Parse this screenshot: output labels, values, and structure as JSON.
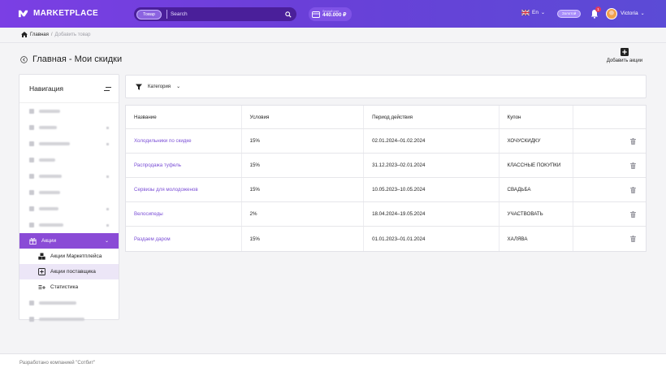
{
  "header": {
    "logo_text": "MARKETPLACE",
    "search": {
      "scope_label": "Товар",
      "placeholder": "Search"
    },
    "balance": {
      "label": "Личный счет",
      "value": "440.000 ₽"
    },
    "language": "En",
    "level_badge": "Золотой",
    "notifications_count": "1",
    "user_name": "Victoria"
  },
  "breadcrumb": {
    "home": "Главная",
    "separator": "/",
    "current": "Добавить товар"
  },
  "page": {
    "title_prefix": "Главная",
    "title_suffix": " - Мои скидки",
    "add_button_label": "Добавить акции"
  },
  "sidebar": {
    "title": "Навигация",
    "active_group": "Акции",
    "sub_items": [
      {
        "label": "Акции Маркетплейса",
        "icon": "boxes-icon"
      },
      {
        "label": "Акции поставщика",
        "icon": "plus-square-icon"
      },
      {
        "label": "Статистика",
        "icon": "list-plus-icon"
      }
    ]
  },
  "filter": {
    "label": "Категория"
  },
  "table": {
    "columns": [
      "Название",
      "Условия",
      "Период действия",
      "Купон"
    ],
    "rows": [
      {
        "name": "Холодильники по скидке",
        "condition": "15%",
        "period": "02.01.2024–01.02.2024",
        "coupon": "ХОЧУСКИДКУ"
      },
      {
        "name": "Распродажа туфель",
        "condition": "15%",
        "period": "31.12.2023–02.01.2024",
        "coupon": "КЛАССНЫЕ ПОКУПКИ"
      },
      {
        "name": "Сервизы для молодоженов",
        "condition": "15%",
        "period": "10.05.2023–10.05.2024",
        "coupon": "СВАДЬБА"
      },
      {
        "name": "Велосипеды",
        "condition": "2%",
        "period": "18.04.2024–19.05.2024",
        "coupon": "УЧАСТВОВАТЬ"
      },
      {
        "name": "Раздаем даром",
        "condition": "15%",
        "period": "01.01.2023–01.01.2024",
        "coupon": "ХАЛЯВА"
      }
    ]
  },
  "footer": {
    "text": "Разработано компанией \"Сотбит\""
  },
  "colors": {
    "accent": "#8a4bd6",
    "link": "#7b4fd6",
    "header_start": "#7b3fe4",
    "header_end": "#5b4bd6"
  }
}
